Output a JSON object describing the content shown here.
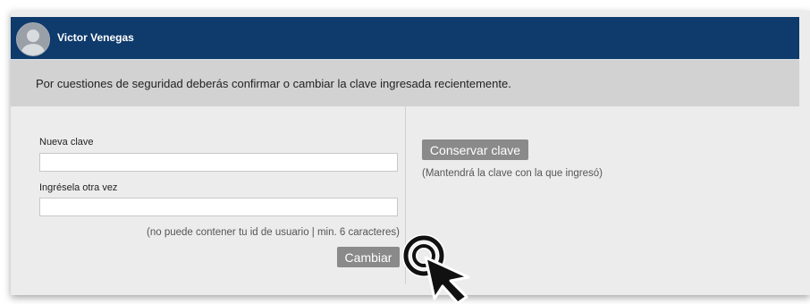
{
  "header": {
    "user_name": "Victor Venegas",
    "background": "#0e3a6c",
    "avatar_icon": "user-avatar-icon"
  },
  "notice": {
    "text": "Por cuestiones de seguridad deberás confirmar o cambiar la clave ingresada recientemente."
  },
  "change_form": {
    "new_password_label": "Nueva clave",
    "new_password_value": "",
    "confirm_password_label": "Ingrésela otra vez",
    "confirm_password_value": "",
    "hint": "(no puede contener tu id de usuario | min. 6 caracteres)",
    "submit_label": "Cambiar"
  },
  "keep_panel": {
    "button_label": "Conservar clave",
    "hint": "(Mantendrá la clave con la que ingresó)"
  },
  "cursor": {
    "icon": "pointer-click-icon"
  }
}
